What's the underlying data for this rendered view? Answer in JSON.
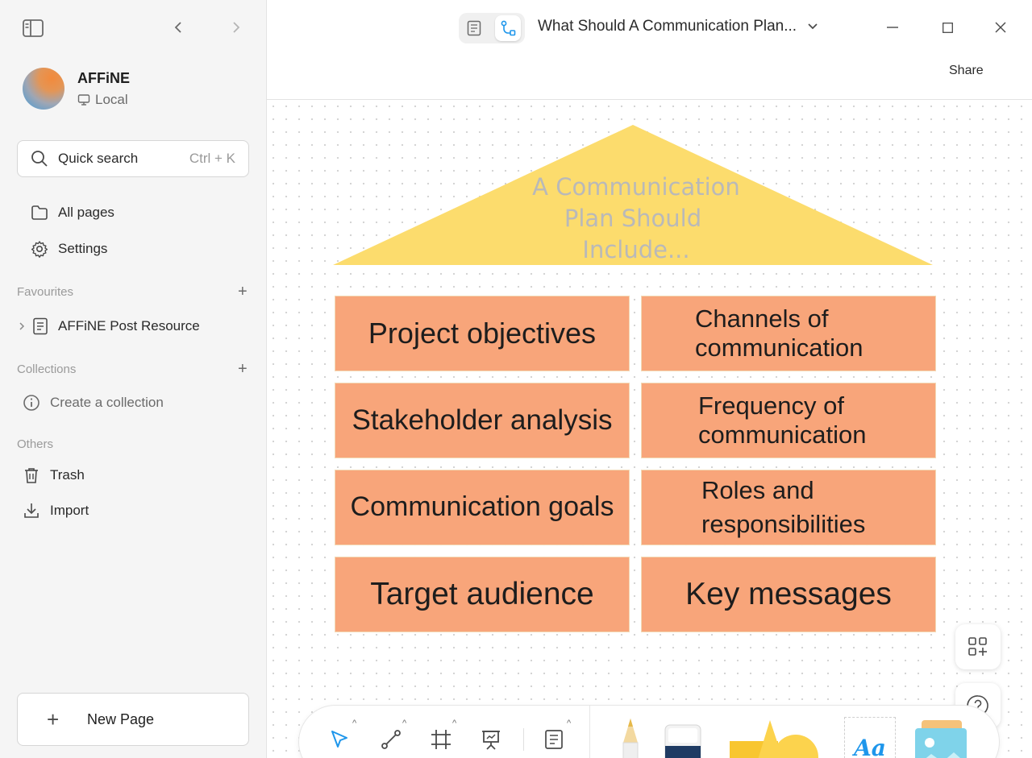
{
  "sidebar": {
    "workspace": {
      "name": "AFFiNE",
      "storage": "Local"
    },
    "search": {
      "label": "Quick search",
      "shortcut": "Ctrl + K"
    },
    "nav": [
      {
        "label": "All pages",
        "icon": "folder-icon"
      },
      {
        "label": "Settings",
        "icon": "gear-icon"
      }
    ],
    "favourites": {
      "heading": "Favourites",
      "items": [
        {
          "label": "AFFiNE Post Resource",
          "icon": "page-icon"
        }
      ]
    },
    "collections": {
      "heading": "Collections",
      "create_label": "Create a collection"
    },
    "others": {
      "heading": "Others",
      "items": [
        {
          "label": "Trash",
          "icon": "trash-icon"
        },
        {
          "label": "Import",
          "icon": "import-icon"
        }
      ]
    },
    "new_page_label": "New Page"
  },
  "header": {
    "title": "What Should A Communication Plan...",
    "share_label": "Share",
    "active_mode": "edgeless"
  },
  "canvas": {
    "triangle": {
      "title_lines": [
        "A Communication",
        "Plan Should",
        "Include..."
      ],
      "fill": "#fcdc6d",
      "text_color": "#b9b9b9"
    },
    "box_fill": "#f8a57a",
    "boxes": [
      {
        "lines": [
          "Project objectives"
        ]
      },
      {
        "lines": [
          "Channels of",
          "communication"
        ]
      },
      {
        "lines": [
          "Stakeholder analysis"
        ]
      },
      {
        "lines": [
          "Frequency of",
          "communication"
        ]
      },
      {
        "lines": [
          "Communication goals"
        ]
      },
      {
        "lines": [
          "Roles and",
          "responsibilities"
        ]
      },
      {
        "lines": [
          "Target audience"
        ]
      },
      {
        "lines": [
          "Key messages"
        ]
      }
    ]
  },
  "toolbar": {
    "tools": [
      "pointer-icon",
      "connector-icon",
      "frame-icon",
      "presentation-icon",
      "note-icon",
      "pen-icon",
      "eraser-icon",
      "shapes-icon",
      "text-icon",
      "image-icon"
    ],
    "text_tool_label": "Aa",
    "accent": "#1e96eb"
  }
}
